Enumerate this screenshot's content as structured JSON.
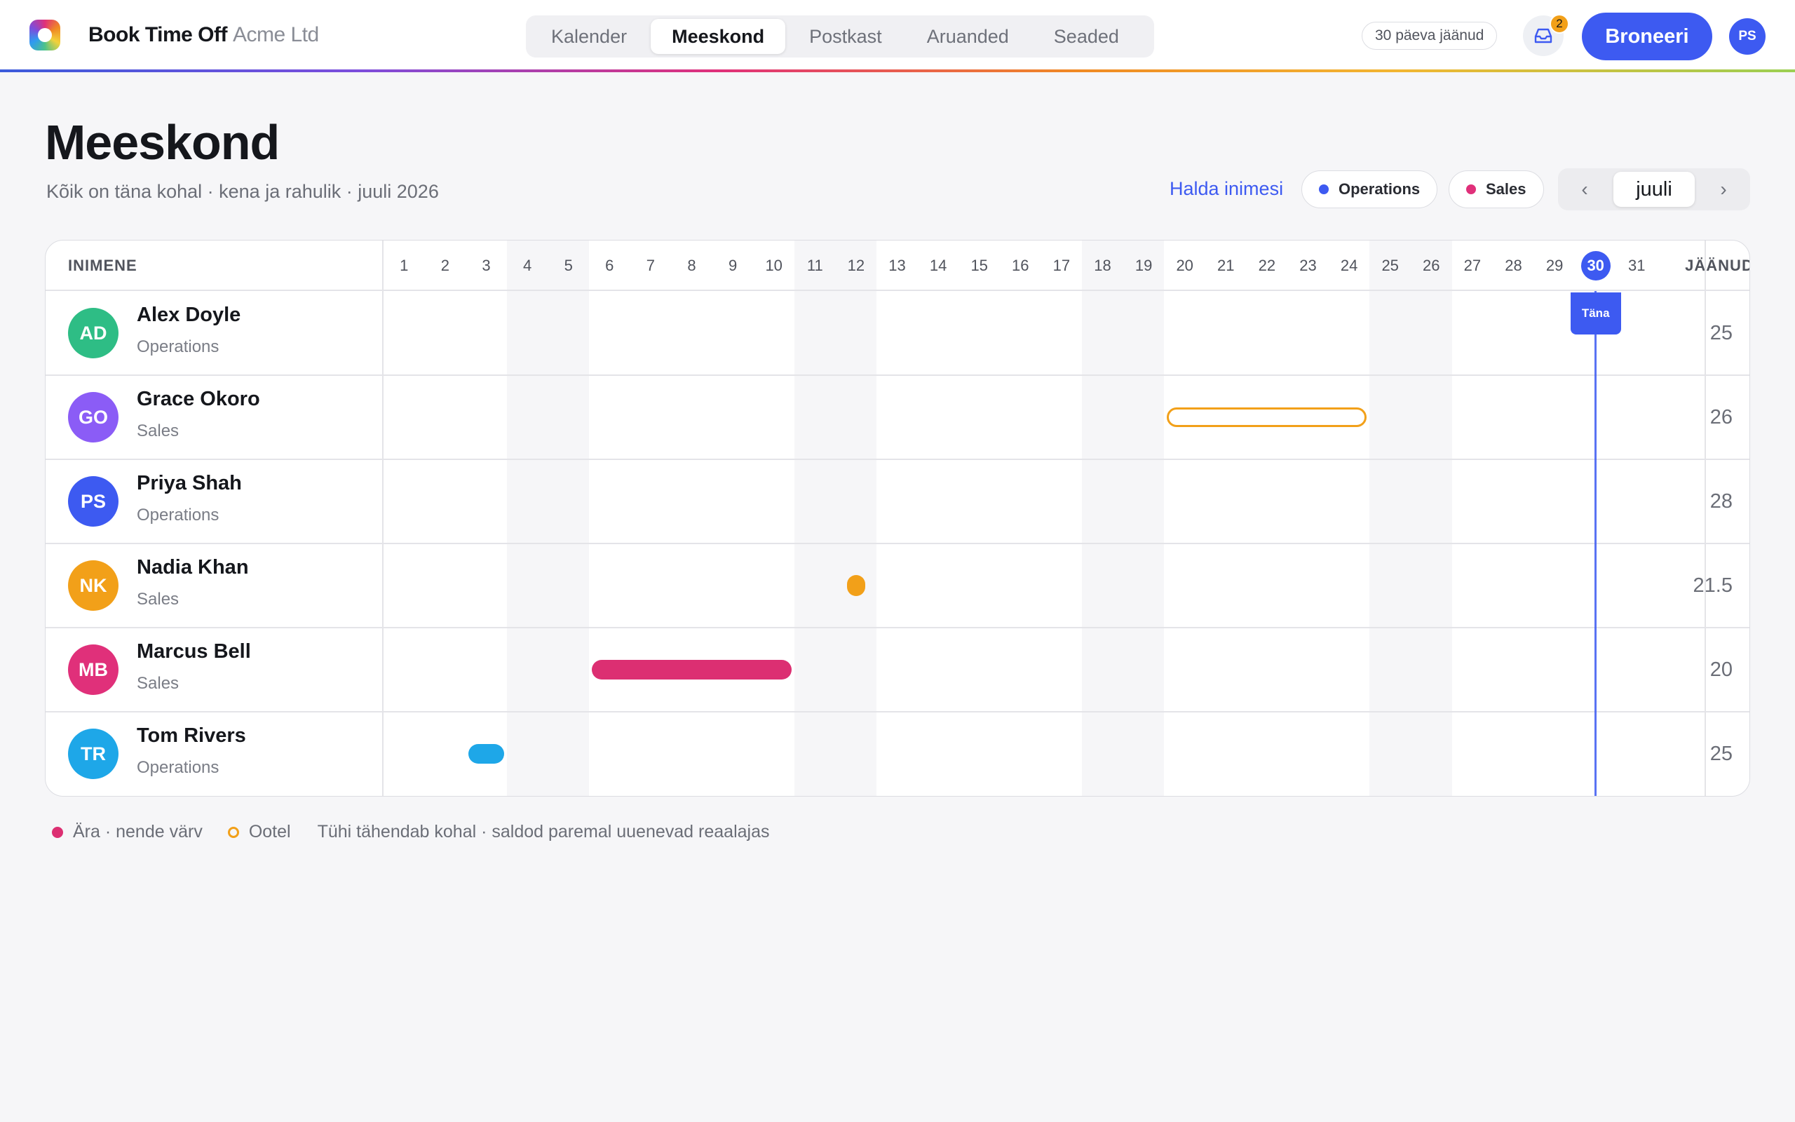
{
  "app": {
    "name": "Book Time Off",
    "org": "Acme Ltd"
  },
  "nav": {
    "tabs": [
      "Kalender",
      "Meeskond",
      "Postkast",
      "Aruanded",
      "Seaded"
    ],
    "active": "Meeskond"
  },
  "header": {
    "days_left": "30 päeva jäänud",
    "inbox_badge": "2",
    "book_label": "Broneeri",
    "user_initials": "PS"
  },
  "page": {
    "title": "Meeskond",
    "subtitle": "Kõik on täna kohal · kena ja rahulik · juuli 2026",
    "manage_label": "Halda inimesi",
    "filters": [
      {
        "label": "Operations",
        "color": "#3d5af1"
      },
      {
        "label": "Sales",
        "color": "#e0307a"
      }
    ],
    "month": {
      "prev": "‹",
      "label": "juuli",
      "next": "›"
    }
  },
  "grid": {
    "person_header": "INIMENE",
    "remaining_header": "JÄÄNUD",
    "days": [
      1,
      2,
      3,
      4,
      5,
      6,
      7,
      8,
      9,
      10,
      11,
      12,
      13,
      14,
      15,
      16,
      17,
      18,
      19,
      20,
      21,
      22,
      23,
      24,
      25,
      26,
      27,
      28,
      29,
      30,
      31
    ],
    "weekend_days": [
      4,
      5,
      11,
      12,
      18,
      19,
      25,
      26
    ],
    "today": 30,
    "today_label": "Täna",
    "people": [
      {
        "initials": "AD",
        "name": "Alex Doyle",
        "team": "Operations",
        "color": "#2ebd85",
        "remaining": "25",
        "absences": []
      },
      {
        "initials": "GO",
        "name": "Grace Okoro",
        "team": "Sales",
        "color": "#8b5cf6",
        "remaining": "26",
        "absences": [
          {
            "start": 20,
            "end": 24,
            "status": "pending",
            "color": "#f2a019"
          }
        ]
      },
      {
        "initials": "PS",
        "name": "Priya Shah",
        "team": "Operations",
        "color": "#3d5af1",
        "remaining": "28",
        "absences": []
      },
      {
        "initials": "NK",
        "name": "Nadia Khan",
        "team": "Sales",
        "color": "#f2a019",
        "remaining": "21.5",
        "absences": [
          {
            "start": 12,
            "end": 12,
            "status": "half",
            "color": "#f2a019"
          }
        ]
      },
      {
        "initials": "MB",
        "name": "Marcus Bell",
        "team": "Sales",
        "color": "#e0307a",
        "remaining": "20",
        "absences": [
          {
            "start": 6,
            "end": 10,
            "status": "away",
            "color": "#dc2f72"
          }
        ]
      },
      {
        "initials": "TR",
        "name": "Tom Rivers",
        "team": "Operations",
        "color": "#1ea7e8",
        "remaining": "25",
        "absences": [
          {
            "start": 3,
            "end": 3,
            "status": "away",
            "color": "#1ea7e8"
          }
        ]
      }
    ]
  },
  "legend": {
    "away_label": "Ära · nende värv",
    "away_color": "#dc2f72",
    "pending_label": "Ootel",
    "pending_color": "#f2a019",
    "note": "Tühi tähendab kohal · saldod paremal uuenevad reaalajas"
  }
}
